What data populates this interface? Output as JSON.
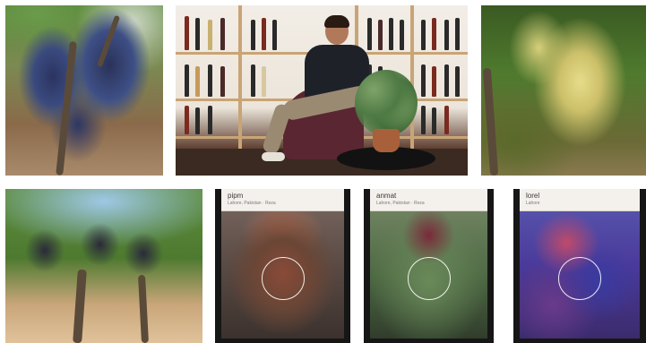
{
  "scan_cards": {
    "card1": {
      "title": "pipm",
      "subtitle": "Lahore, Pakistan · Reza"
    },
    "card2": {
      "title": "anmat",
      "subtitle": "Lahore, Pakistan · Reza"
    },
    "card3": {
      "title": "lorel",
      "subtitle": "Lahore"
    }
  }
}
